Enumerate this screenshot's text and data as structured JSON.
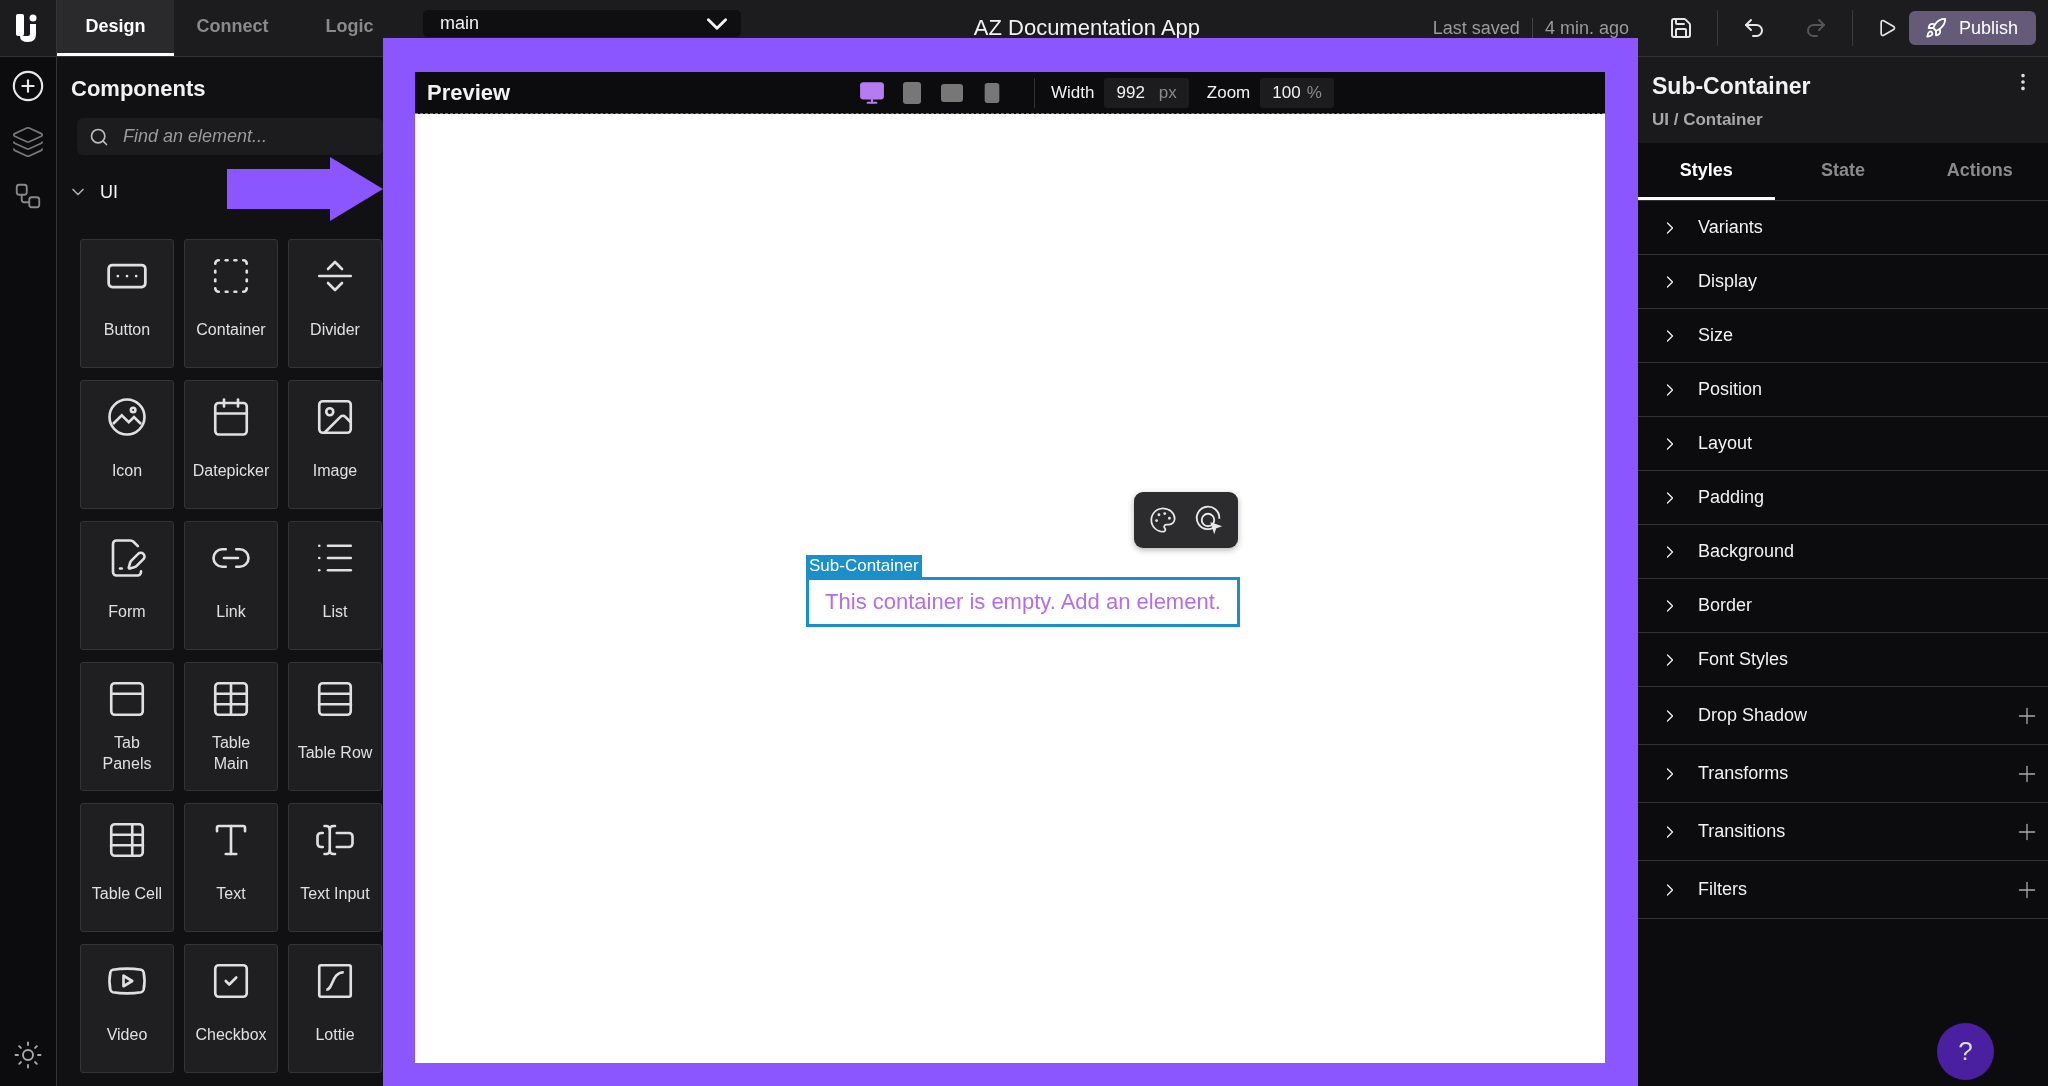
{
  "topbar": {
    "tabs": [
      {
        "label": "Design",
        "selected": true
      },
      {
        "label": "Connect",
        "selected": false
      },
      {
        "label": "Logic",
        "selected": false
      }
    ],
    "branch": {
      "value": "main"
    },
    "title": "AZ Documentation App",
    "save_status": {
      "label": "Last saved",
      "time": "4 min. ago"
    },
    "history": [
      {
        "kind": "undo",
        "disabled": false
      },
      {
        "kind": "redo",
        "disabled": true
      }
    ],
    "publish": {
      "label": "Publish"
    }
  },
  "components_panel": {
    "title": "Components",
    "search": {
      "placeholder": "Find an element..."
    },
    "section": {
      "label": "UI",
      "expanded": true
    },
    "items": [
      {
        "kind": "button",
        "label": "Button"
      },
      {
        "kind": "container",
        "label": "Container"
      },
      {
        "kind": "divider",
        "label": "Divider"
      },
      {
        "kind": "icon",
        "label": "Icon"
      },
      {
        "kind": "datepicker",
        "label": "Datepicker"
      },
      {
        "kind": "image",
        "label": "Image"
      },
      {
        "kind": "form",
        "label": "Form"
      },
      {
        "kind": "link",
        "label": "Link"
      },
      {
        "kind": "list",
        "label": "List"
      },
      {
        "kind": "tabpanels",
        "label": "Tab\nPanels"
      },
      {
        "kind": "tablemain",
        "label": "Table\nMain"
      },
      {
        "kind": "tablerow",
        "label": "Table Row"
      },
      {
        "kind": "tablecell",
        "label": "Table Cell"
      },
      {
        "kind": "text",
        "label": "Text"
      },
      {
        "kind": "textinput",
        "label": "Text Input"
      },
      {
        "kind": "video",
        "label": "Video"
      },
      {
        "kind": "checkbox",
        "label": "Checkbox"
      },
      {
        "kind": "lottie",
        "label": "Lottie"
      }
    ]
  },
  "preview": {
    "title": "Preview",
    "devices": [
      {
        "kind": "desktop",
        "selected": true
      },
      {
        "kind": "tablet",
        "selected": false
      },
      {
        "kind": "landscape",
        "selected": false
      },
      {
        "kind": "phone",
        "selected": false
      }
    ],
    "width": {
      "label": "Width",
      "value": "992",
      "unit": "px"
    },
    "zoom": {
      "label": "Zoom",
      "value": "100",
      "unit": "%"
    },
    "selected_element": {
      "label": "Sub-Container",
      "placeholder": "This container is empty. Add an element."
    }
  },
  "inspector": {
    "title": "Sub-Container",
    "path": "UI / Container",
    "tabs": [
      {
        "label": "Styles",
        "selected": true
      },
      {
        "label": "State",
        "selected": false
      },
      {
        "label": "Actions",
        "selected": false
      }
    ],
    "sections": [
      {
        "label": "Variants",
        "expanded": false,
        "addable": false
      },
      {
        "label": "Display",
        "expanded": false,
        "addable": false
      },
      {
        "label": "Size",
        "expanded": false,
        "addable": false
      },
      {
        "label": "Position",
        "expanded": false,
        "addable": false
      },
      {
        "label": "Layout",
        "expanded": false,
        "addable": false
      },
      {
        "label": "Padding",
        "expanded": false,
        "addable": false
      },
      {
        "label": "Background",
        "expanded": false,
        "addable": false
      },
      {
        "label": "Border",
        "expanded": false,
        "addable": false
      },
      {
        "label": "Font Styles",
        "expanded": false,
        "addable": false
      },
      {
        "label": "Drop Shadow",
        "expanded": false,
        "addable": true
      },
      {
        "label": "Transforms",
        "expanded": false,
        "addable": true
      },
      {
        "label": "Transitions",
        "expanded": false,
        "addable": true
      },
      {
        "label": "Filters",
        "expanded": false,
        "addable": true
      }
    ]
  },
  "help": {
    "label": "?"
  }
}
